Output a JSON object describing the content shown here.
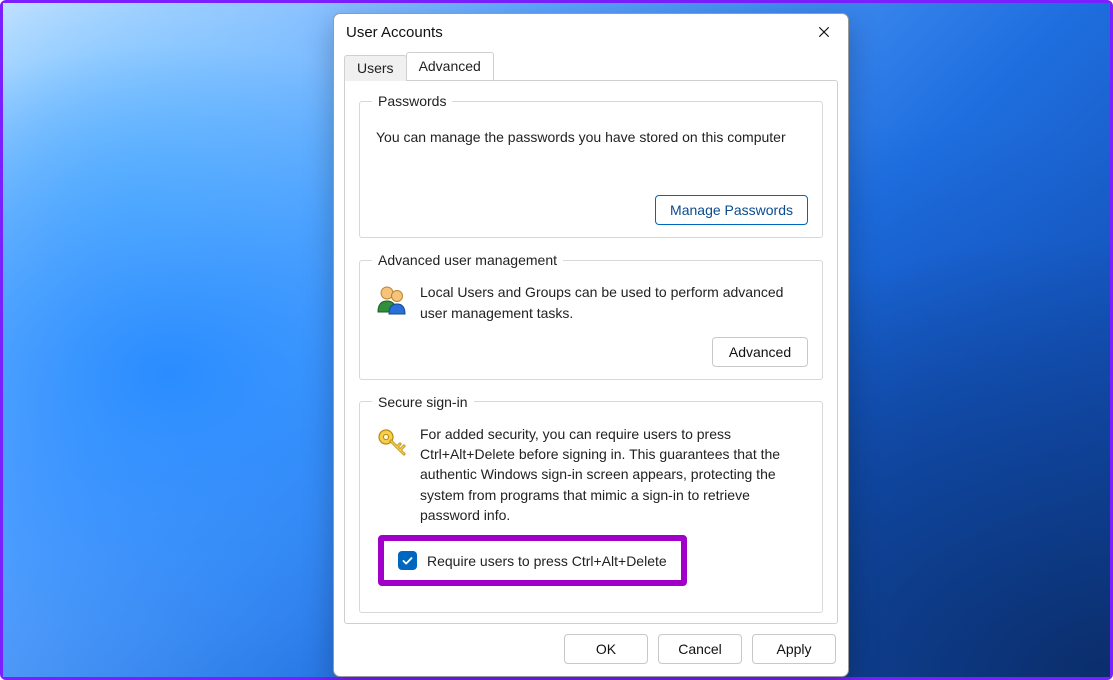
{
  "dialog": {
    "title": "User Accounts",
    "tabs": {
      "users": "Users",
      "advanced": "Advanced",
      "active": "advanced"
    },
    "passwords_group": {
      "legend": "Passwords",
      "description": "You can manage the passwords you have stored on this computer",
      "button": "Manage Passwords"
    },
    "advanced_group": {
      "legend": "Advanced user management",
      "description": "Local Users and Groups can be used to perform advanced user management tasks.",
      "button": "Advanced"
    },
    "secure_group": {
      "legend": "Secure sign-in",
      "description": "For added security, you can require users to press Ctrl+Alt+Delete before signing in. This guarantees that the authentic Windows sign-in screen appears, protecting the system from programs that mimic a sign-in to retrieve password info.",
      "checkbox": {
        "checked": true,
        "label": "Require users to press Ctrl+Alt+Delete"
      }
    },
    "footer": {
      "ok": "OK",
      "cancel": "Cancel",
      "apply": "Apply"
    }
  }
}
